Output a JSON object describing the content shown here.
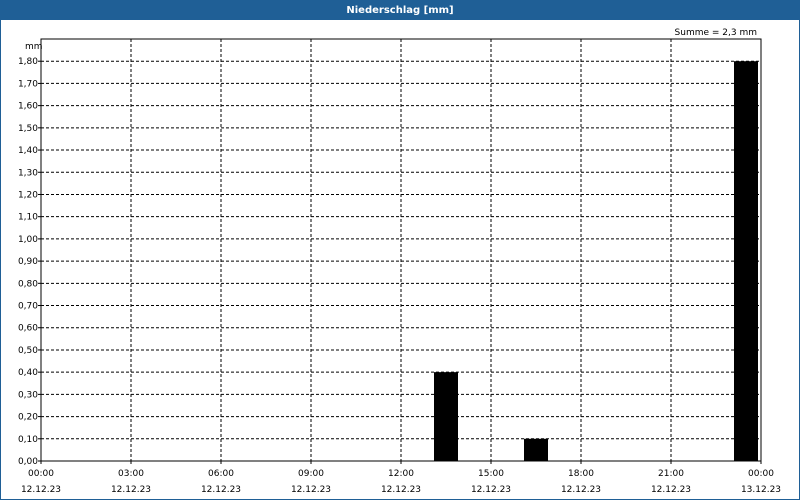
{
  "window": {
    "title": "Niederschlag [mm]"
  },
  "chart_data": {
    "type": "bar",
    "title": "Niederschlag [mm]",
    "ylabel": "mm",
    "annotation": "Summe = 2,3 mm",
    "ylim": [
      0,
      1.9
    ],
    "yticks": [
      0,
      0.1,
      0.2,
      0.3,
      0.4,
      0.5,
      0.6,
      0.7,
      0.8,
      0.9,
      1.0,
      1.1,
      1.2,
      1.3,
      1.4,
      1.5,
      1.6,
      1.7,
      1.8
    ],
    "ytick_labels": [
      "0,00",
      "0,10",
      "0,20",
      "0,30",
      "0,40",
      "0,50",
      "0,60",
      "0,70",
      "0,80",
      "0,90",
      "1,00",
      "1,10",
      "1,20",
      "1,30",
      "1,40",
      "1,50",
      "1,60",
      "1,70",
      "1,80"
    ],
    "xlim_hours": [
      0,
      24
    ],
    "xticks": [
      {
        "time": "00:00",
        "date": "12.12.23"
      },
      {
        "time": "03:00",
        "date": "12.12.23"
      },
      {
        "time": "06:00",
        "date": "12.12.23"
      },
      {
        "time": "09:00",
        "date": "12.12.23"
      },
      {
        "time": "12:00",
        "date": "12.12.23"
      },
      {
        "time": "15:00",
        "date": "12.12.23"
      },
      {
        "time": "18:00",
        "date": "12.12.23"
      },
      {
        "time": "21:00",
        "date": "12.12.23"
      },
      {
        "time": "00:00",
        "date": "13.12.23"
      }
    ],
    "bars": [
      {
        "start": "12.12.23 13:00",
        "end": "12.12.23 14:00",
        "value": 0.4
      },
      {
        "start": "12.12.23 16:00",
        "end": "12.12.23 17:00",
        "value": 0.1
      },
      {
        "start": "12.12.23 23:00",
        "end": "13.12.23 00:00",
        "value": 1.8
      }
    ],
    "bar_color": "#000000",
    "grid": true
  }
}
